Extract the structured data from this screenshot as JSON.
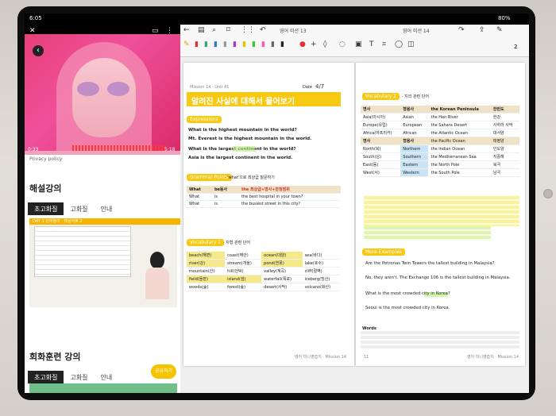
{
  "status": {
    "time": "6:05",
    "battery": "80%"
  },
  "video": {
    "time_left": "0:33",
    "time_right": "5:18",
    "privacy": "Privacy policy"
  },
  "left_panel": {
    "section1": "해설강의",
    "tabs1": [
      "초고화질",
      "고화질",
      "안내"
    ],
    "thumb_title": "DAY 1 단어정리 · 핵심어휘 2",
    "section2": "회화훈련 강의",
    "tabs2": [
      "초고화질",
      "고화질",
      "안내"
    ],
    "chip": "공유하기"
  },
  "toolbar": {
    "tab1": "영어 미션 13",
    "tab2": "영어 미션 14",
    "page_indicator": "2"
  },
  "left_page": {
    "header": "Mission 14 · Unit 41",
    "title": "알려진 사실에 대해서 물어보기",
    "date_label": "Date",
    "date_value": "4/7",
    "expr_tag": "Expressions",
    "sentences": [
      "What is the highest mountain in the world?",
      "Mt. Everest is the highest mountain in the world.",
      "What is the largest continent in the world?",
      "Asia is the largest continent in the world."
    ],
    "grammar_tag": "Grammar Points",
    "grammar_desc": "· 'what'으로 최상급 질문하기",
    "grammar_table": {
      "headers": [
        "What",
        "be동사",
        "the 최상급+명사+한정범위"
      ],
      "rows": [
        [
          "What",
          "is",
          "the best hospital in your town?"
        ],
        [
          "What",
          "is",
          "the busiest street in this city?"
        ]
      ]
    },
    "vocab_tag": "Vocabulary 1",
    "vocab_desc": "· 지형 관련 단어",
    "vocab_rows": [
      [
        "beach(해변)",
        "coast(해안)",
        "ocean(대양)",
        "sea(바다)"
      ],
      [
        "river(강)",
        "stream(개울)",
        "pond(연못)",
        "lake(호수)"
      ],
      [
        "mountain(산)",
        "hill(언덕)",
        "valley(계곡)",
        "cliff(절벽)"
      ],
      [
        "field(들판)",
        "island(섬)",
        "waterfall(폭포)",
        "iceberg(빙산)"
      ],
      [
        "woods(숲)",
        "forest(숲)",
        "desert(사막)",
        "volcano(화산)"
      ]
    ],
    "footer": "영어 미니영습지 · Mission 14"
  },
  "right_page": {
    "vocab_tag": "Vocabulary 2",
    "vocab_desc": "· 지리 관련 단어",
    "geo_table": {
      "headers": [
        "명사",
        "형용사",
        "the Korean Peninsula",
        "한반도"
      ],
      "rows": [
        [
          "Asia(아시아)",
          "Asian",
          "the Han River",
          "한강"
        ],
        [
          "Europe(유럽)",
          "European",
          "the Sahara Desert",
          "사하라 사막"
        ],
        [
          "Africa(아프리카)",
          "African",
          "the Atlantic Ocean",
          "대서양"
        ],
        [
          "명사",
          "형용사",
          "the Pacific Ocean",
          "태평양"
        ],
        [
          "North(북)",
          "Northern",
          "the Indian Ocean",
          "인도양"
        ],
        [
          "South(남)",
          "Southern",
          "the Mediterranean Sea",
          "지중해"
        ],
        [
          "East(동)",
          "Eastern",
          "the North Pole",
          "북극"
        ],
        [
          "West(서)",
          "Western",
          "the South Pole",
          "남극"
        ]
      ]
    },
    "more_tag": "More Examples",
    "examples": [
      "Are the Petronas Twin Towers the tallest building in Malaysia?",
      "No, they aren't. The Exchange 106 is the tallest building in Malaysia.",
      "What is the most crowded city in Korea?",
      "Seoul is the most crowded city in Korea."
    ],
    "words_label": "Words",
    "footer_num": "11",
    "footer": "영어 미니영습지 · Mission 14"
  }
}
